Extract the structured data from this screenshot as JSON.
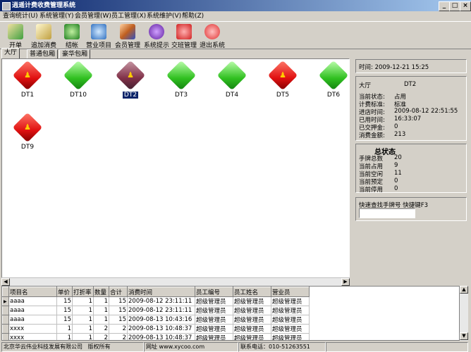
{
  "window": {
    "title": "逍遥计费收费管理系统"
  },
  "menu": [
    "查询统计(U)",
    "系统管理(Y)",
    "会员管理(W)",
    "员工管理(X)",
    "系统维护(V)",
    "帮助(Z)"
  ],
  "toolbar": [
    "开单",
    "追加消费",
    "结帐",
    "营业项目",
    "会员管理",
    "系统提示",
    "交班管理",
    "退出系统"
  ],
  "tabs": [
    "大厅",
    "普通包厢",
    "豪华包厢"
  ],
  "tables": [
    {
      "name": "DT1",
      "state": "red"
    },
    {
      "name": "DT10",
      "state": "green"
    },
    {
      "name": "DT2",
      "state": "selected"
    },
    {
      "name": "DT3",
      "state": "green"
    },
    {
      "name": "DT4",
      "state": "green"
    },
    {
      "name": "DT5",
      "state": "red"
    },
    {
      "name": "DT6",
      "state": "green"
    },
    {
      "name": "DT9",
      "state": "red"
    }
  ],
  "info": {
    "time_label": "时间:",
    "time_value": "2009-12-21 15:25",
    "hall": "大厅",
    "table": "DT2",
    "rows": [
      {
        "label": "当前状态:",
        "value": "占用"
      },
      {
        "label": "计费标准:",
        "value": "标准"
      },
      {
        "label": "进店时间:",
        "value": "2009-08-12 22:51:55"
      },
      {
        "label": "已用时间:",
        "value": "16:33:07"
      },
      {
        "label": "已交押金:",
        "value": "0"
      },
      {
        "label": "消费金额:",
        "value": "213"
      }
    ]
  },
  "summary": {
    "title": "总状态",
    "rows": [
      {
        "label": "手牌总数",
        "value": "20"
      },
      {
        "label": "当前占用",
        "value": "9"
      },
      {
        "label": "当前空闲",
        "value": "11"
      },
      {
        "label": "当前预定",
        "value": "0"
      },
      {
        "label": "当前停用",
        "value": "0"
      }
    ]
  },
  "quick_search": {
    "label": "快速查找手牌号",
    "hotkey": "快捷键F3",
    "value": ""
  },
  "grid": {
    "headers": [
      "项目名",
      "单价",
      "打折率",
      "数量",
      "合计",
      "消费时间",
      "员工编号",
      "员工姓名",
      "营业员"
    ],
    "rows": [
      [
        "aaaa",
        "15",
        "1",
        "1",
        "15",
        "2009-08-12 23:11:11",
        "超级管理员",
        "超级管理员",
        "超级管理员"
      ],
      [
        "aaaa",
        "15",
        "1",
        "1",
        "15",
        "2009-08-12 23:11:11",
        "超级管理员",
        "超级管理员",
        "超级管理员"
      ],
      [
        "aaaa",
        "15",
        "1",
        "1",
        "15",
        "2009-08-13 10:43:16",
        "超级管理员",
        "超级管理员",
        "超级管理员"
      ],
      [
        "xxxx",
        "1",
        "1",
        "2",
        "2",
        "2009-08-13 10:48:37",
        "超级管理员",
        "超级管理员",
        "超级管理员"
      ],
      [
        "xxxx",
        "1",
        "1",
        "2",
        "2",
        "2009-08-13 10:48:37",
        "超级管理员",
        "超级管理员",
        "超级管理员"
      ]
    ]
  },
  "status": {
    "company": "北京华云伟业科技发展有限公司",
    "rights": "版权所有",
    "url": "网址 www.xycoo.com",
    "phone": "联系电话：010-51263551"
  }
}
